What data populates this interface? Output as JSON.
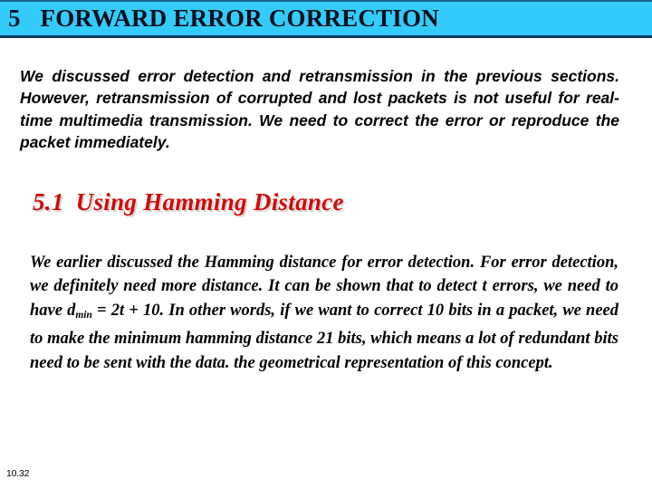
{
  "slide": {
    "title_banner": {
      "number": "5",
      "heading": "FORWARD ERROR CORRECTION",
      "background_color": "#33ccfa",
      "border_color": "#103a5c",
      "text_color": "#0a0f1e"
    },
    "intro_paragraph": "We discussed error detection and retransmission in the previous sections. However, retransmission of corrupted and lost packets is not useful for real-time multimedia transmission. We need to correct the error or reproduce the packet immediately.",
    "section_heading": {
      "number": "5.1",
      "text": "Using Hamming Distance",
      "color": "#d00b0b"
    },
    "body_paragraph": {
      "part1": "We earlier discussed the Hamming distance for error detection. For error detection, we definitely need more distance. It can be shown that to detect t errors, we need to have d",
      "subscript": "min",
      "part2": " = 2t + 10. In other words, if we want to correct 10 bits in a packet, we need to make the minimum hamming distance 21 bits, which means a lot of redundant bits need to be sent with the data. the geometrical representation of this concept."
    },
    "footer": {
      "page_number": "10.32"
    }
  }
}
